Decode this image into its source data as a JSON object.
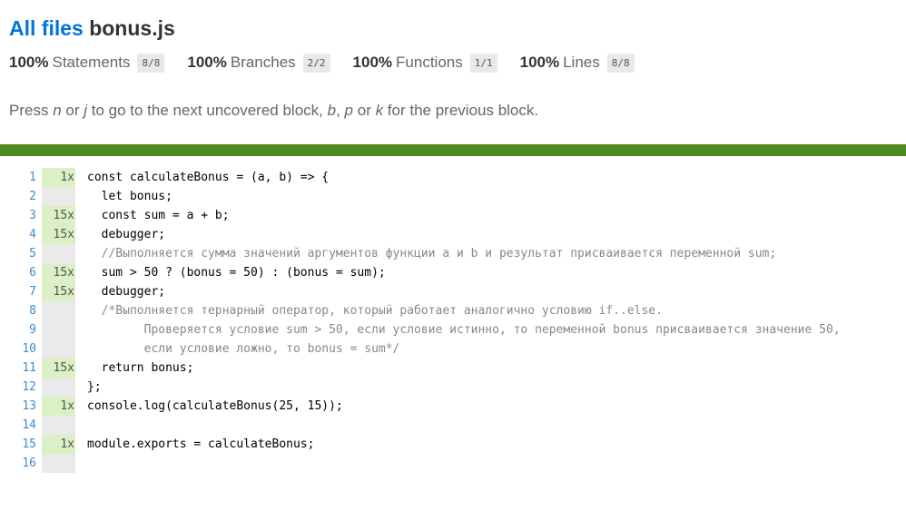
{
  "header": {
    "all_files_link": "All files",
    "file_name": "bonus.js"
  },
  "summary": [
    {
      "pct": "100%",
      "label": "Statements",
      "fraction": "8/8"
    },
    {
      "pct": "100%",
      "label": "Branches",
      "fraction": "2/2"
    },
    {
      "pct": "100%",
      "label": "Functions",
      "fraction": "1/1"
    },
    {
      "pct": "100%",
      "label": "Lines",
      "fraction": "8/8"
    }
  ],
  "hint": {
    "t1": "Press ",
    "k1": "n",
    "t2": " or ",
    "k2": "j",
    "t3": " to go to the next uncovered block, ",
    "k3": "b",
    "t4": ", ",
    "k4": "p",
    "t5": " or ",
    "k5": "k",
    "t6": " for the previous block."
  },
  "status_color": "#4d8a1e",
  "lines": [
    {
      "n": "1",
      "count": "1x",
      "covered": true,
      "code": "const calculateBonus = (a, b) => {"
    },
    {
      "n": "2",
      "count": "",
      "covered": false,
      "code": "  let bonus;"
    },
    {
      "n": "3",
      "count": "15x",
      "covered": true,
      "code": "  const sum = a + b;"
    },
    {
      "n": "4",
      "count": "15x",
      "covered": true,
      "code": "  debugger;"
    },
    {
      "n": "5",
      "count": "",
      "covered": false,
      "code": "  //Выполняется сумма значений аргументов функции a и b и результат присваивается переменной sum;"
    },
    {
      "n": "6",
      "count": "15x",
      "covered": true,
      "code": "  sum > 50 ? (bonus = 50) : (bonus = sum);"
    },
    {
      "n": "7",
      "count": "15x",
      "covered": true,
      "code": "  debugger;"
    },
    {
      "n": "8",
      "count": "",
      "covered": false,
      "code": "  /*Выполняется тернарный оператор, который работает аналогично условию if..else."
    },
    {
      "n": "9",
      "count": "",
      "covered": false,
      "code": "        Проверяется условие sum > 50, если условие истинно, то переменной bonus присваивается значение 50,"
    },
    {
      "n": "10",
      "count": "",
      "covered": false,
      "code": "        если условие ложно, то bonus = sum*/"
    },
    {
      "n": "11",
      "count": "15x",
      "covered": true,
      "code": "  return bonus;"
    },
    {
      "n": "12",
      "count": "",
      "covered": false,
      "code": "};"
    },
    {
      "n": "13",
      "count": "1x",
      "covered": true,
      "code": "console.log(calculateBonus(25, 15));"
    },
    {
      "n": "14",
      "count": "",
      "covered": false,
      "code": ""
    },
    {
      "n": "15",
      "count": "1x",
      "covered": true,
      "code": "module.exports = calculateBonus;"
    },
    {
      "n": "16",
      "count": "",
      "covered": false,
      "code": ""
    }
  ]
}
